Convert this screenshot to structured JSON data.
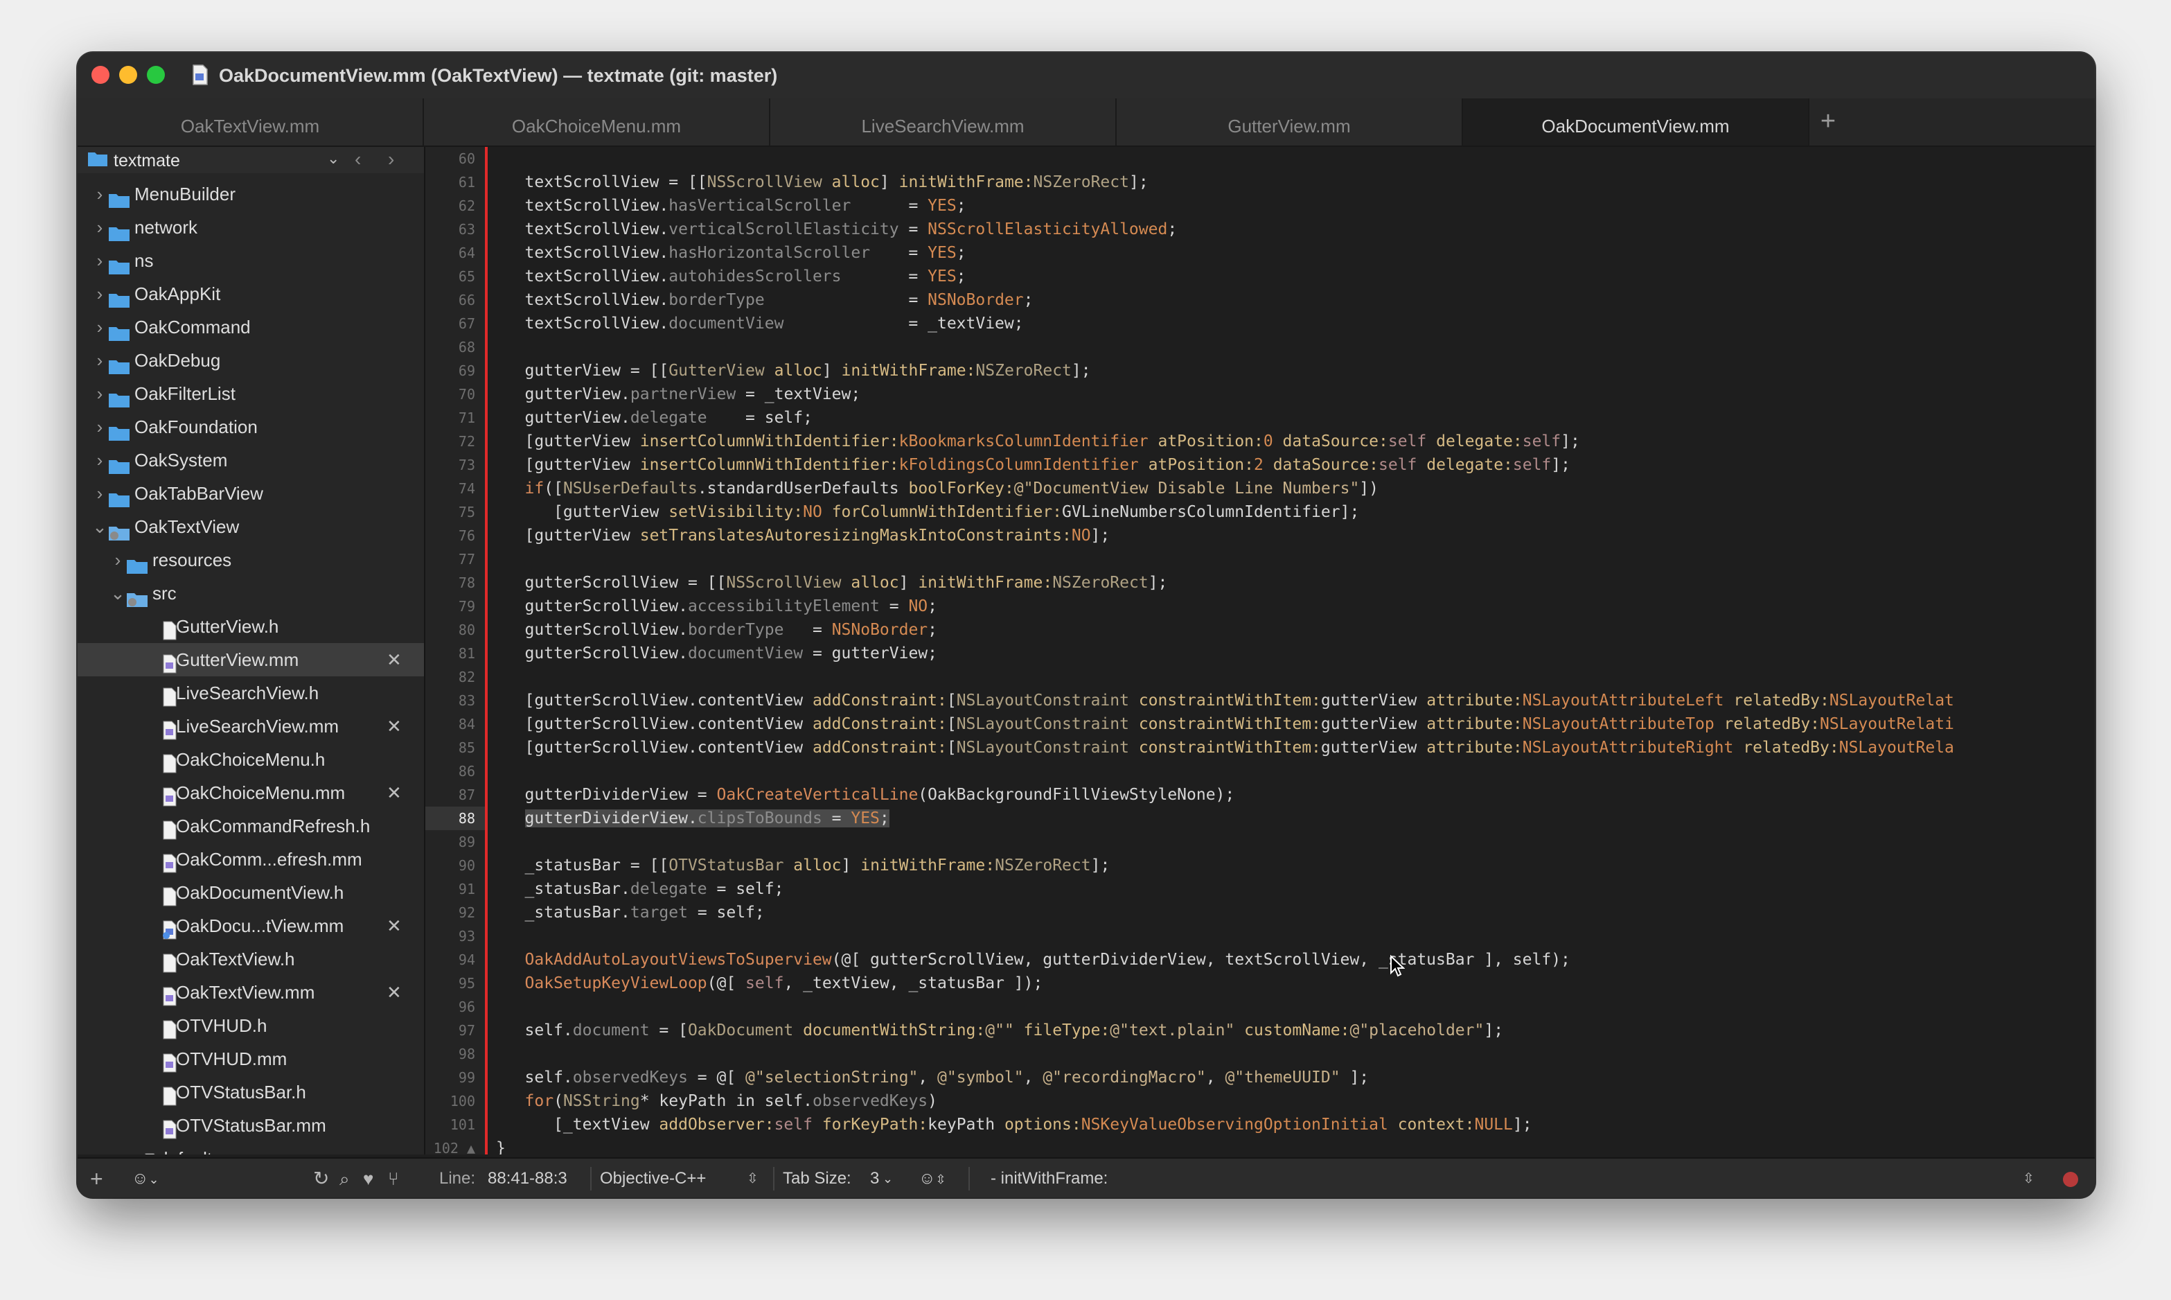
{
  "window": {
    "title": "OakDocumentView.mm (OakTextView) — textmate (git: master)"
  },
  "tabs": [
    {
      "label": "OakTextView.mm",
      "active": false
    },
    {
      "label": "OakChoiceMenu.mm",
      "active": false
    },
    {
      "label": "LiveSearchView.mm",
      "active": false
    },
    {
      "label": "GutterView.mm",
      "active": false
    },
    {
      "label": "OakDocumentView.mm",
      "active": true
    }
  ],
  "tab_add_label": "+",
  "sidebar": {
    "project": "textmate",
    "items": [
      {
        "label": "MenuBuilder",
        "type": "folder",
        "depth": 0,
        "disc": "›"
      },
      {
        "label": "network",
        "type": "folder",
        "depth": 0,
        "disc": "›"
      },
      {
        "label": "ns",
        "type": "folder",
        "depth": 0,
        "disc": "›"
      },
      {
        "label": "OakAppKit",
        "type": "folder",
        "depth": 0,
        "disc": "›"
      },
      {
        "label": "OakCommand",
        "type": "folder",
        "depth": 0,
        "disc": "›"
      },
      {
        "label": "OakDebug",
        "type": "folder",
        "depth": 0,
        "disc": "›"
      },
      {
        "label": "OakFilterList",
        "type": "folder",
        "depth": 0,
        "disc": "›"
      },
      {
        "label": "OakFoundation",
        "type": "folder",
        "depth": 0,
        "disc": "›"
      },
      {
        "label": "OakSystem",
        "type": "folder",
        "depth": 0,
        "disc": "›"
      },
      {
        "label": "OakTabBarView",
        "type": "folder",
        "depth": 0,
        "disc": "›"
      },
      {
        "label": "OakTextView",
        "type": "folder-open",
        "depth": 0,
        "disc": "⌄"
      },
      {
        "label": "resources",
        "type": "folder",
        "depth": 1,
        "disc": "›"
      },
      {
        "label": "src",
        "type": "folder-open",
        "depth": 1,
        "disc": "⌄"
      },
      {
        "label": "GutterView.h",
        "type": "file",
        "depth": 2
      },
      {
        "label": "GutterView.mm",
        "type": "file-m",
        "depth": 2,
        "selected": true,
        "close": "✕"
      },
      {
        "label": "LiveSearchView.h",
        "type": "file",
        "depth": 2
      },
      {
        "label": "LiveSearchView.mm",
        "type": "file-m",
        "depth": 2,
        "close": "✕"
      },
      {
        "label": "OakChoiceMenu.h",
        "type": "file",
        "depth": 2
      },
      {
        "label": "OakChoiceMenu.mm",
        "type": "file-m",
        "depth": 2,
        "close": "✕"
      },
      {
        "label": "OakCommandRefresh.h",
        "type": "file",
        "depth": 2
      },
      {
        "label": "OakComm...efresh.mm",
        "type": "file-m",
        "depth": 2
      },
      {
        "label": "OakDocumentView.h",
        "type": "file",
        "depth": 2
      },
      {
        "label": "OakDocu...tView.mm",
        "type": "file-m-mod",
        "depth": 2,
        "close": "✕"
      },
      {
        "label": "OakTextView.h",
        "type": "file",
        "depth": 2
      },
      {
        "label": "OakTextView.mm",
        "type": "file-m",
        "depth": 2,
        "close": "✕"
      },
      {
        "label": "OTVHUD.h",
        "type": "file",
        "depth": 2
      },
      {
        "label": "OTVHUD.mm",
        "type": "file-m",
        "depth": 2
      },
      {
        "label": "OTVStatusBar.h",
        "type": "file",
        "depth": 2
      },
      {
        "label": "OTVStatusBar.mm",
        "type": "file-m",
        "depth": 2
      },
      {
        "label": "default.rave",
        "type": "file-m",
        "depth": 1
      }
    ]
  },
  "editor": {
    "current_line": 88,
    "lines": [
      {
        "n": "60",
        "html": ""
      },
      {
        "n": "61",
        "html": "   textScrollView = [[<span class='tok-k'>NSScrollView</span> <span class='tok-m'>alloc</span>] <span class='tok-m'>initWithFrame:</span><span class='tok-k'>NSZeroRect</span>];"
      },
      {
        "n": "62",
        "html": "   textScrollView.<span class='tok-p'>hasVerticalScroller</span>      = <span class='tok-c'>YES</span>;"
      },
      {
        "n": "63",
        "html": "   textScrollView.<span class='tok-p'>verticalScrollElasticity</span> = <span class='tok-c'>NSScrollElasticityAllowed</span>;"
      },
      {
        "n": "64",
        "html": "   textScrollView.<span class='tok-p'>hasHorizontalScroller</span>    = <span class='tok-c'>YES</span>;"
      },
      {
        "n": "65",
        "html": "   textScrollView.<span class='tok-p'>autohidesScrollers</span>       = <span class='tok-c'>YES</span>;"
      },
      {
        "n": "66",
        "html": "   textScrollView.<span class='tok-p'>borderType</span>               = <span class='tok-c'>NSNoBorder</span>;"
      },
      {
        "n": "67",
        "html": "   textScrollView.<span class='tok-p'>documentView</span>             = _textView;"
      },
      {
        "n": "68",
        "html": ""
      },
      {
        "n": "69",
        "html": "   gutterView = [[<span class='tok-k'>GutterView</span> <span class='tok-m'>alloc</span>] <span class='tok-m'>initWithFrame:</span><span class='tok-k'>NSZeroRect</span>];"
      },
      {
        "n": "70",
        "html": "   gutterView.<span class='tok-p'>partnerView</span> = _textView;"
      },
      {
        "n": "71",
        "html": "   gutterView.<span class='tok-p'>delegate</span>    = self;"
      },
      {
        "n": "72",
        "html": "   [gutterView <span class='tok-m'>insertColumnWithIdentifier:</span><span class='tok-c'>kBookmarksColumnIdentifier</span> <span class='tok-m'>atPosition:</span><span class='tok-c'>0</span> <span class='tok-m'>dataSource:</span><span class='tok-self'>self</span> <span class='tok-m'>delegate:</span><span class='tok-self'>self</span>];"
      },
      {
        "n": "73",
        "html": "   [gutterView <span class='tok-m'>insertColumnWithIdentifier:</span><span class='tok-c'>kFoldingsColumnIdentifier</span> <span class='tok-m'>atPosition:</span><span class='tok-c'>2</span> <span class='tok-m'>dataSource:</span><span class='tok-self'>self</span> <span class='tok-m'>delegate:</span><span class='tok-self'>self</span>];"
      },
      {
        "n": "74",
        "html": "   <span class='tok-f'>if</span>([<span class='tok-k'>NSUserDefaults</span>.standardUserDefaults <span class='tok-m'>boolForKey:</span><span class='tok-s'>@\"DocumentView Disable Line Numbers\"</span>])"
      },
      {
        "n": "75",
        "html": "      [gutterView <span class='tok-m'>setVisibility:</span><span class='tok-c'>NO</span> <span class='tok-m'>forColumnWithIdentifier:</span>GVLineNumbersColumnIdentifier];"
      },
      {
        "n": "76",
        "html": "   [gutterView <span class='tok-m'>setTranslatesAutoresizingMaskIntoConstraints:</span><span class='tok-c'>NO</span>];"
      },
      {
        "n": "77",
        "html": ""
      },
      {
        "n": "78",
        "html": "   gutterScrollView = [[<span class='tok-k'>NSScrollView</span> <span class='tok-m'>alloc</span>] <span class='tok-m'>initWithFrame:</span><span class='tok-k'>NSZeroRect</span>];"
      },
      {
        "n": "79",
        "html": "   gutterScrollView.<span class='tok-p'>accessibilityElement</span> = <span class='tok-c'>NO</span>;"
      },
      {
        "n": "80",
        "html": "   gutterScrollView.<span class='tok-p'>borderType</span>   = <span class='tok-c'>NSNoBorder</span>;"
      },
      {
        "n": "81",
        "html": "   gutterScrollView.<span class='tok-p'>documentView</span> = gutterView;"
      },
      {
        "n": "82",
        "html": ""
      },
      {
        "n": "83",
        "html": "   [gutterScrollView.contentView <span class='tok-m'>addConstraint:</span>[<span class='tok-k'>NSLayoutConstraint</span> <span class='tok-m'>constraintWithItem:</span>gutterView <span class='tok-m'>attribute:</span><span class='tok-c'>NSLayoutAttributeLeft</span> <span class='tok-m'>relatedBy:</span><span class='tok-c'>NSLayoutRelat</span>"
      },
      {
        "n": "84",
        "html": "   [gutterScrollView.contentView <span class='tok-m'>addConstraint:</span>[<span class='tok-k'>NSLayoutConstraint</span> <span class='tok-m'>constraintWithItem:</span>gutterView <span class='tok-m'>attribute:</span><span class='tok-c'>NSLayoutAttributeTop</span> <span class='tok-m'>relatedBy:</span><span class='tok-c'>NSLayoutRelati</span>"
      },
      {
        "n": "85",
        "html": "   [gutterScrollView.contentView <span class='tok-m'>addConstraint:</span>[<span class='tok-k'>NSLayoutConstraint</span> <span class='tok-m'>constraintWithItem:</span>gutterView <span class='tok-m'>attribute:</span><span class='tok-c'>NSLayoutAttributeRight</span> <span class='tok-m'>relatedBy:</span><span class='tok-c'>NSLayoutRela</span>"
      },
      {
        "n": "86",
        "html": ""
      },
      {
        "n": "87",
        "html": "   gutterDividerView = <span class='tok-f'>OakCreateVerticalLine</span>(OakBackgroundFillViewStyleNone);"
      },
      {
        "n": "88",
        "html": "   <span class='sel'>gutterDividerView.<span class='tok-p'>clipsToBounds</span> = <span class='tok-c'>YES</span>;</span>"
      },
      {
        "n": "89",
        "html": ""
      },
      {
        "n": "90",
        "html": "   _statusBar = [[<span class='tok-k'>OTVStatusBar</span> <span class='tok-m'>alloc</span>] <span class='tok-m'>initWithFrame:</span><span class='tok-k'>NSZeroRect</span>];"
      },
      {
        "n": "91",
        "html": "   _statusBar.<span class='tok-p'>delegate</span> = self;"
      },
      {
        "n": "92",
        "html": "   _statusBar.<span class='tok-p'>target</span> = self;"
      },
      {
        "n": "93",
        "html": ""
      },
      {
        "n": "94",
        "html": "   <span class='tok-f'>OakAddAutoLayoutViewsToSuperview</span>(@[ gutterScrollView, gutterDividerView, textScrollView, _statusBar ], self);"
      },
      {
        "n": "95",
        "html": "   <span class='tok-f'>OakSetupKeyViewLoop</span>(@[ <span class='tok-self'>self</span>, _textView, _statusBar ]);"
      },
      {
        "n": "96",
        "html": ""
      },
      {
        "n": "97",
        "html": "   self.<span class='tok-p'>document</span> = [<span class='tok-k'>OakDocument</span> <span class='tok-m'>documentWithString:</span><span class='tok-s'>@\"\"</span> <span class='tok-m'>fileType:</span><span class='tok-s'>@\"text.plain\"</span> <span class='tok-m'>customName:</span><span class='tok-s'>@\"placeholder\"</span>];"
      },
      {
        "n": "98",
        "html": ""
      },
      {
        "n": "99",
        "html": "   self.<span class='tok-p'>observedKeys</span> = @[ <span class='tok-s'>@\"selectionString\"</span>, <span class='tok-s'>@\"symbol\"</span>, <span class='tok-s'>@\"recordingMacro\"</span>, <span class='tok-s'>@\"themeUUID\"</span> ];"
      },
      {
        "n": "100",
        "html": "   <span class='tok-f'>for</span>(<span class='tok-k'>NSString</span>* keyPath in self.<span class='tok-p'>observedKeys</span>)"
      },
      {
        "n": "101",
        "html": "      [_textView <span class='tok-m'>addObserver:</span><span class='tok-self'>self</span> <span class='tok-m'>forKeyPath:</span>keyPath <span class='tok-m'>options:</span><span class='tok-c'>NSKeyValueObservingOptionInitial</span> <span class='tok-m'>context:</span><span class='tok-c'>NULL</span>];"
      },
      {
        "n": "102 ▲",
        "html": "}"
      }
    ]
  },
  "statusbar": {
    "add_label": "+",
    "line_label": "Line:",
    "line_value": "88:41-88:3",
    "language": "Objective-C++",
    "tab_size_label": "Tab Size:",
    "tab_size_value": "3",
    "symbol": "- initWithFrame:"
  },
  "colors": {
    "accent_red": "#e02a2a",
    "folder_blue": "#4fa3e6"
  }
}
